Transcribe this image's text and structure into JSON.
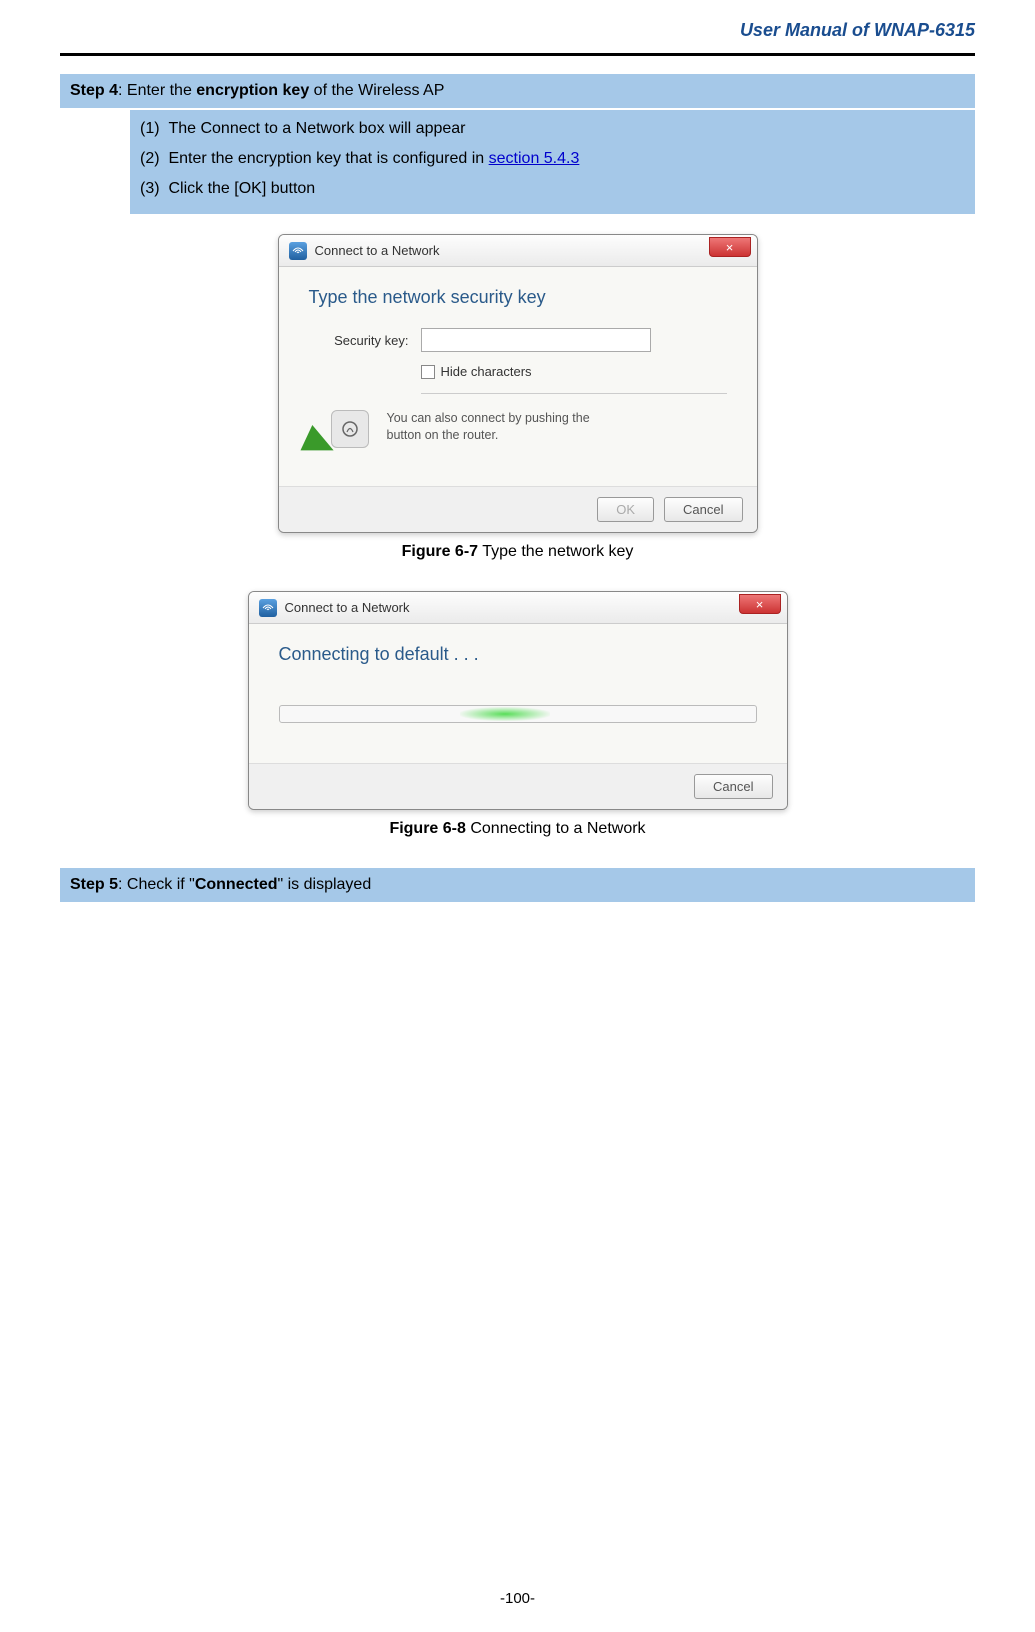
{
  "header": {
    "title": "User Manual of WNAP-6315"
  },
  "step4": {
    "label": "Step 4",
    "text_pre": ": Enter the ",
    "bold": "encryption key",
    "text_post": " of the Wireless AP",
    "items": [
      {
        "num": "(1)",
        "text": "The Connect to a Network box will appear"
      },
      {
        "num": "(2)",
        "text_pre": "Enter the encryption key that is configured in ",
        "link": "section 5.4.3"
      },
      {
        "num": "(3)",
        "text": "Click the [OK] button"
      }
    ]
  },
  "dialog1": {
    "title": "Connect to a Network",
    "heading": "Type the network security key",
    "securityLabel": "Security key:",
    "hideChars": "Hide characters",
    "hintLine1": "You can also connect by pushing the",
    "hintLine2": "button on the router.",
    "okBtn": "OK",
    "cancelBtn": "Cancel",
    "close": "×"
  },
  "figure1": {
    "bold": "Figure 6-7",
    "text": " Type the network key"
  },
  "dialog2": {
    "title": "Connect to a Network",
    "heading": "Connecting to default . . .",
    "cancelBtn": "Cancel",
    "close": "×"
  },
  "figure2": {
    "bold": "Figure 6-8",
    "text": " Connecting to a Network"
  },
  "step5": {
    "label": "Step 5",
    "text_pre": ": Check if \"",
    "bold": "Connected",
    "text_post": "\" is displayed"
  },
  "footer": {
    "page": "-100-"
  }
}
